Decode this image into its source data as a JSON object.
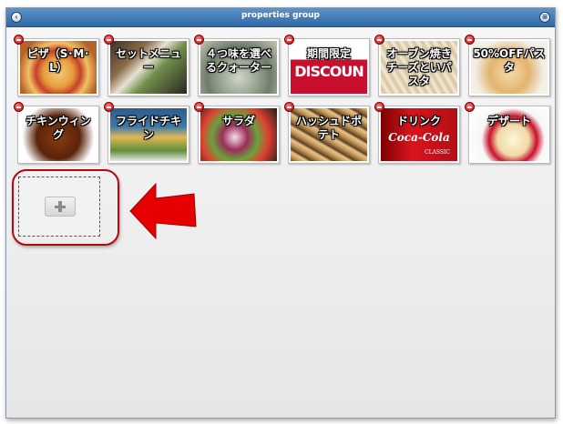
{
  "window": {
    "title": "properties group"
  },
  "titlebar": {
    "back_icon": "back-arrow-icon",
    "menu_icon": "menu-icon"
  },
  "tiles": [
    {
      "label": "ピザ（S･M･L）"
    },
    {
      "label": "セットメニュー"
    },
    {
      "label": "４つ味を選べるクォーター"
    },
    {
      "label": "期間限定"
    },
    {
      "label": "オーブン焼きチーズといパスタ"
    },
    {
      "label": "50%OFFパスタ"
    },
    {
      "label": "チキンウィング"
    },
    {
      "label": "フライドチキン"
    },
    {
      "label": "サラダ"
    },
    {
      "label": "ハッシュドポテト"
    },
    {
      "label": "ドリンク"
    },
    {
      "label": "デザート"
    }
  ],
  "photo_text": {
    "discount": "DISCOUN",
    "cola": "Coca-Cola",
    "cola_sub": "CLASSIC"
  },
  "annotation": {
    "color": "#e60000",
    "ring_color": "#b3080c"
  }
}
